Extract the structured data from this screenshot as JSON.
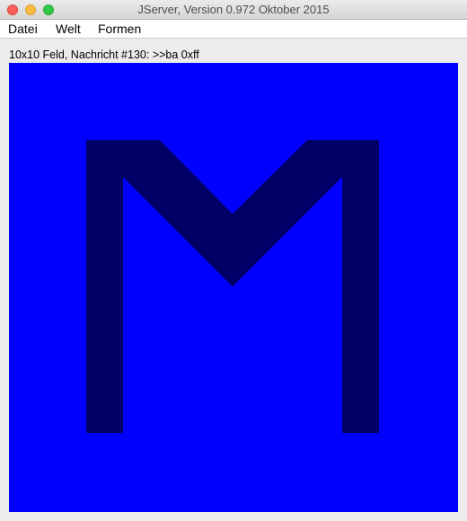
{
  "window": {
    "title": "JServer, Version 0.972 Oktober 2015"
  },
  "menu": {
    "items": [
      {
        "label": "Datei"
      },
      {
        "label": "Welt"
      },
      {
        "label": "Formen"
      }
    ]
  },
  "status": {
    "text": "10x10 Feld, Nachricht #130: >>ba 0xff"
  },
  "board": {
    "background_color": "#0000ff",
    "shape_color": "#000066",
    "shape": "letter-M"
  }
}
